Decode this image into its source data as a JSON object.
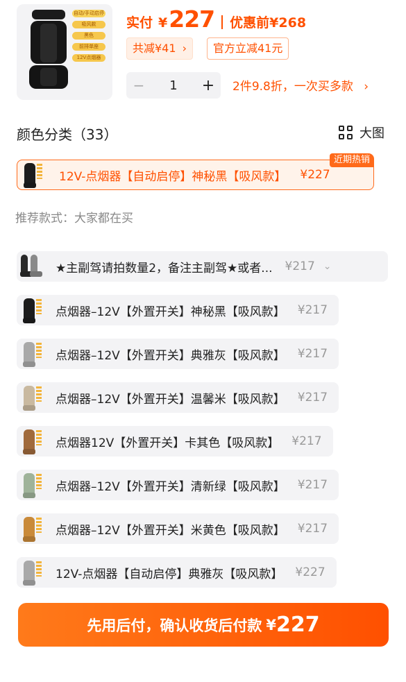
{
  "product": {
    "image_tags": [
      "自动/手动启停",
      "吸风款",
      "黑色",
      "前排单座",
      "12V点烟器"
    ]
  },
  "price": {
    "label": "实付",
    "currency": "¥",
    "value": "227",
    "original_label": "优惠前",
    "original_value": "¥268"
  },
  "discounts": {
    "total_saved": "共减¥41",
    "total_saved_chevron": "›",
    "official": "官方立减41元"
  },
  "quantity": {
    "minus": "−",
    "value": "1",
    "plus": "+"
  },
  "promo": {
    "text": "2件9.8折，一次买多款",
    "chevron": "›"
  },
  "variants": {
    "title": "颜色分类（33）",
    "big_view_label": "大图",
    "selected": {
      "name": "12V-点烟器【自动启停】神秘黑【吸风款】",
      "price": "¥227",
      "badge": "近期热销",
      "seat_color": "#1c1c1c"
    },
    "recommend_text": "推荐款式：大家都在买",
    "items": [
      {
        "name": "★主副驾请拍数量2，备注主副驾★或者...",
        "price": "¥217",
        "seat_color": "#3a3a3a",
        "chevron": "⌄"
      },
      {
        "name": "点烟器–12V【外置开关】神秘黑【吸风款】",
        "price": "¥217",
        "seat_color": "#1c1c1c"
      },
      {
        "name": "点烟器–12V【外置开关】典雅灰【吸风款】",
        "price": "¥217",
        "seat_color": "#a9a9a9"
      },
      {
        "name": "点烟器–12V【外置开关】温馨米【吸风款】",
        "price": "¥217",
        "seat_color": "#c9b9a0"
      },
      {
        "name": "点烟器12V【外置开关】卡其色【吸风款】",
        "price": "¥217",
        "seat_color": "#a06a3c"
      },
      {
        "name": "点烟器–12V【外置开关】清新绿【吸风款】",
        "price": "¥217",
        "seat_color": "#9fb39a"
      },
      {
        "name": "点烟器–12V【外置开关】米黄色【吸风款】",
        "price": "¥217",
        "seat_color": "#c98a3a"
      },
      {
        "name": "12V-点烟器【自动启停】典雅灰【吸风款】",
        "price": "¥227",
        "seat_color": "#a9a9a9"
      }
    ]
  },
  "cta": {
    "text": "先用后付，确认收货后付款",
    "currency": "¥",
    "value": "227"
  },
  "colors": {
    "accent": "#ff5000",
    "option_bg": "#f3f3f5",
    "selected_bg": "#fff3ea"
  }
}
